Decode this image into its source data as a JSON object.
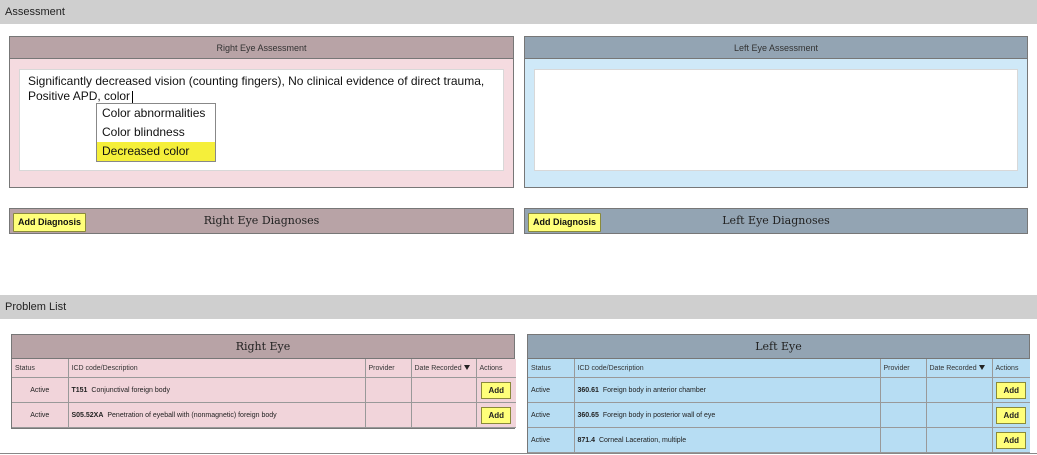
{
  "assessment": {
    "section_title": "Assessment",
    "right": {
      "title": "Right Eye Assessment",
      "text": "Significantly decreased vision (counting fingers), No clinical evidence of direct trauma, Positive APD, color",
      "autocomplete": [
        "Color abnormalities",
        "Color blindness",
        "Decreased color"
      ],
      "selected_index": 2
    },
    "left": {
      "title": "Left Eye Assessment",
      "text": ""
    }
  },
  "diagnoses": {
    "right": {
      "button": "Add Diagnosis",
      "title": "Right Eye Diagnoses"
    },
    "left": {
      "button": "Add Diagnosis",
      "title": "Left Eye Diagnoses"
    }
  },
  "problem_list": {
    "section_title": "Problem List",
    "columns": [
      "Status",
      "ICD code/Description",
      "Provider",
      "Date Recorded",
      "Actions"
    ],
    "right": {
      "title": "Right Eye",
      "rows": [
        {
          "status": "Active",
          "code": "T151",
          "desc": "Conjunctival foreign body",
          "provider": "",
          "date": "",
          "action": "Add"
        },
        {
          "status": "Active",
          "code": "S05.52XA",
          "desc": "Penetration of eyeball with (nonmagnetic) foreign body",
          "provider": "",
          "date": "",
          "action": "Add"
        }
      ]
    },
    "left": {
      "title": "Left Eye",
      "rows": [
        {
          "status": "Active",
          "code": "360.61",
          "desc": "Foreign body in anterior chamber",
          "provider": "",
          "date": "",
          "action": "Add"
        },
        {
          "status": "Active",
          "code": "360.65",
          "desc": "Foreign body in posterior wall of eye",
          "provider": "",
          "date": "",
          "action": "Add"
        },
        {
          "status": "Active",
          "code": "871.4",
          "desc": "Corneal Laceration, multiple",
          "provider": "",
          "date": "",
          "action": "Add"
        }
      ]
    }
  },
  "colors": {
    "right_header": "#b8a3a6",
    "right_bg": "#f5dbe0",
    "left_header": "#93a4b3",
    "left_bg": "#cfe9f8",
    "button_yellow": "#ffff7a",
    "highlight": "#f5ef3a"
  },
  "icons": {
    "sort": "sort-desc-icon"
  }
}
